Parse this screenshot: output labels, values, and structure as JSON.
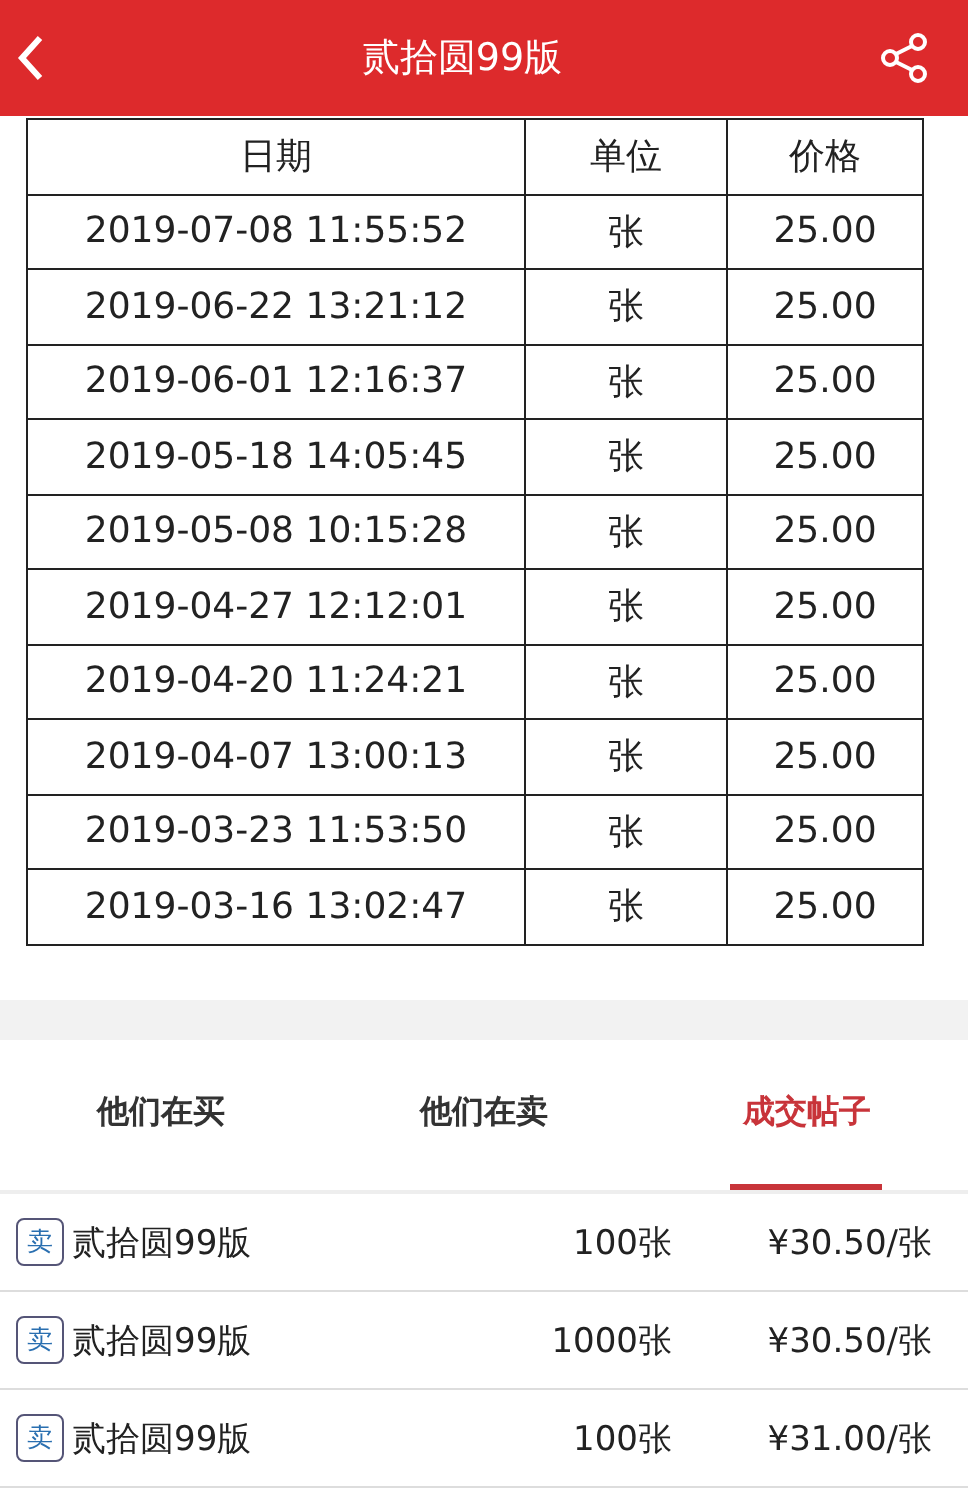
{
  "header": {
    "title": "贰拾圆99版"
  },
  "table": {
    "columns": [
      "日期",
      "单位",
      "价格"
    ],
    "rows": [
      [
        "2019-07-08 11:55:52",
        "张",
        "25.00"
      ],
      [
        "2019-06-22 13:21:12",
        "张",
        "25.00"
      ],
      [
        "2019-06-01 12:16:37",
        "张",
        "25.00"
      ],
      [
        "2019-05-18 14:05:45",
        "张",
        "25.00"
      ],
      [
        "2019-05-08 10:15:28",
        "张",
        "25.00"
      ],
      [
        "2019-04-27 12:12:01",
        "张",
        "25.00"
      ],
      [
        "2019-04-20 11:24:21",
        "张",
        "25.00"
      ],
      [
        "2019-04-07 13:00:13",
        "张",
        "25.00"
      ],
      [
        "2019-03-23 11:53:50",
        "张",
        "25.00"
      ],
      [
        "2019-03-16 13:02:47",
        "张",
        "25.00"
      ]
    ]
  },
  "tabs": [
    {
      "label": "他们在买",
      "selected": false
    },
    {
      "label": "他们在卖",
      "selected": false
    },
    {
      "label": "成交帖子",
      "selected": true
    }
  ],
  "listings": [
    {
      "badge": "卖",
      "name": "贰拾圆99版",
      "quantity": "100张",
      "price": "¥30.50/张"
    },
    {
      "badge": "卖",
      "name": "贰拾圆99版",
      "quantity": "1000张",
      "price": "¥30.50/张"
    },
    {
      "badge": "卖",
      "name": "贰拾圆99版",
      "quantity": "100张",
      "price": "¥31.00/张"
    }
  ]
}
